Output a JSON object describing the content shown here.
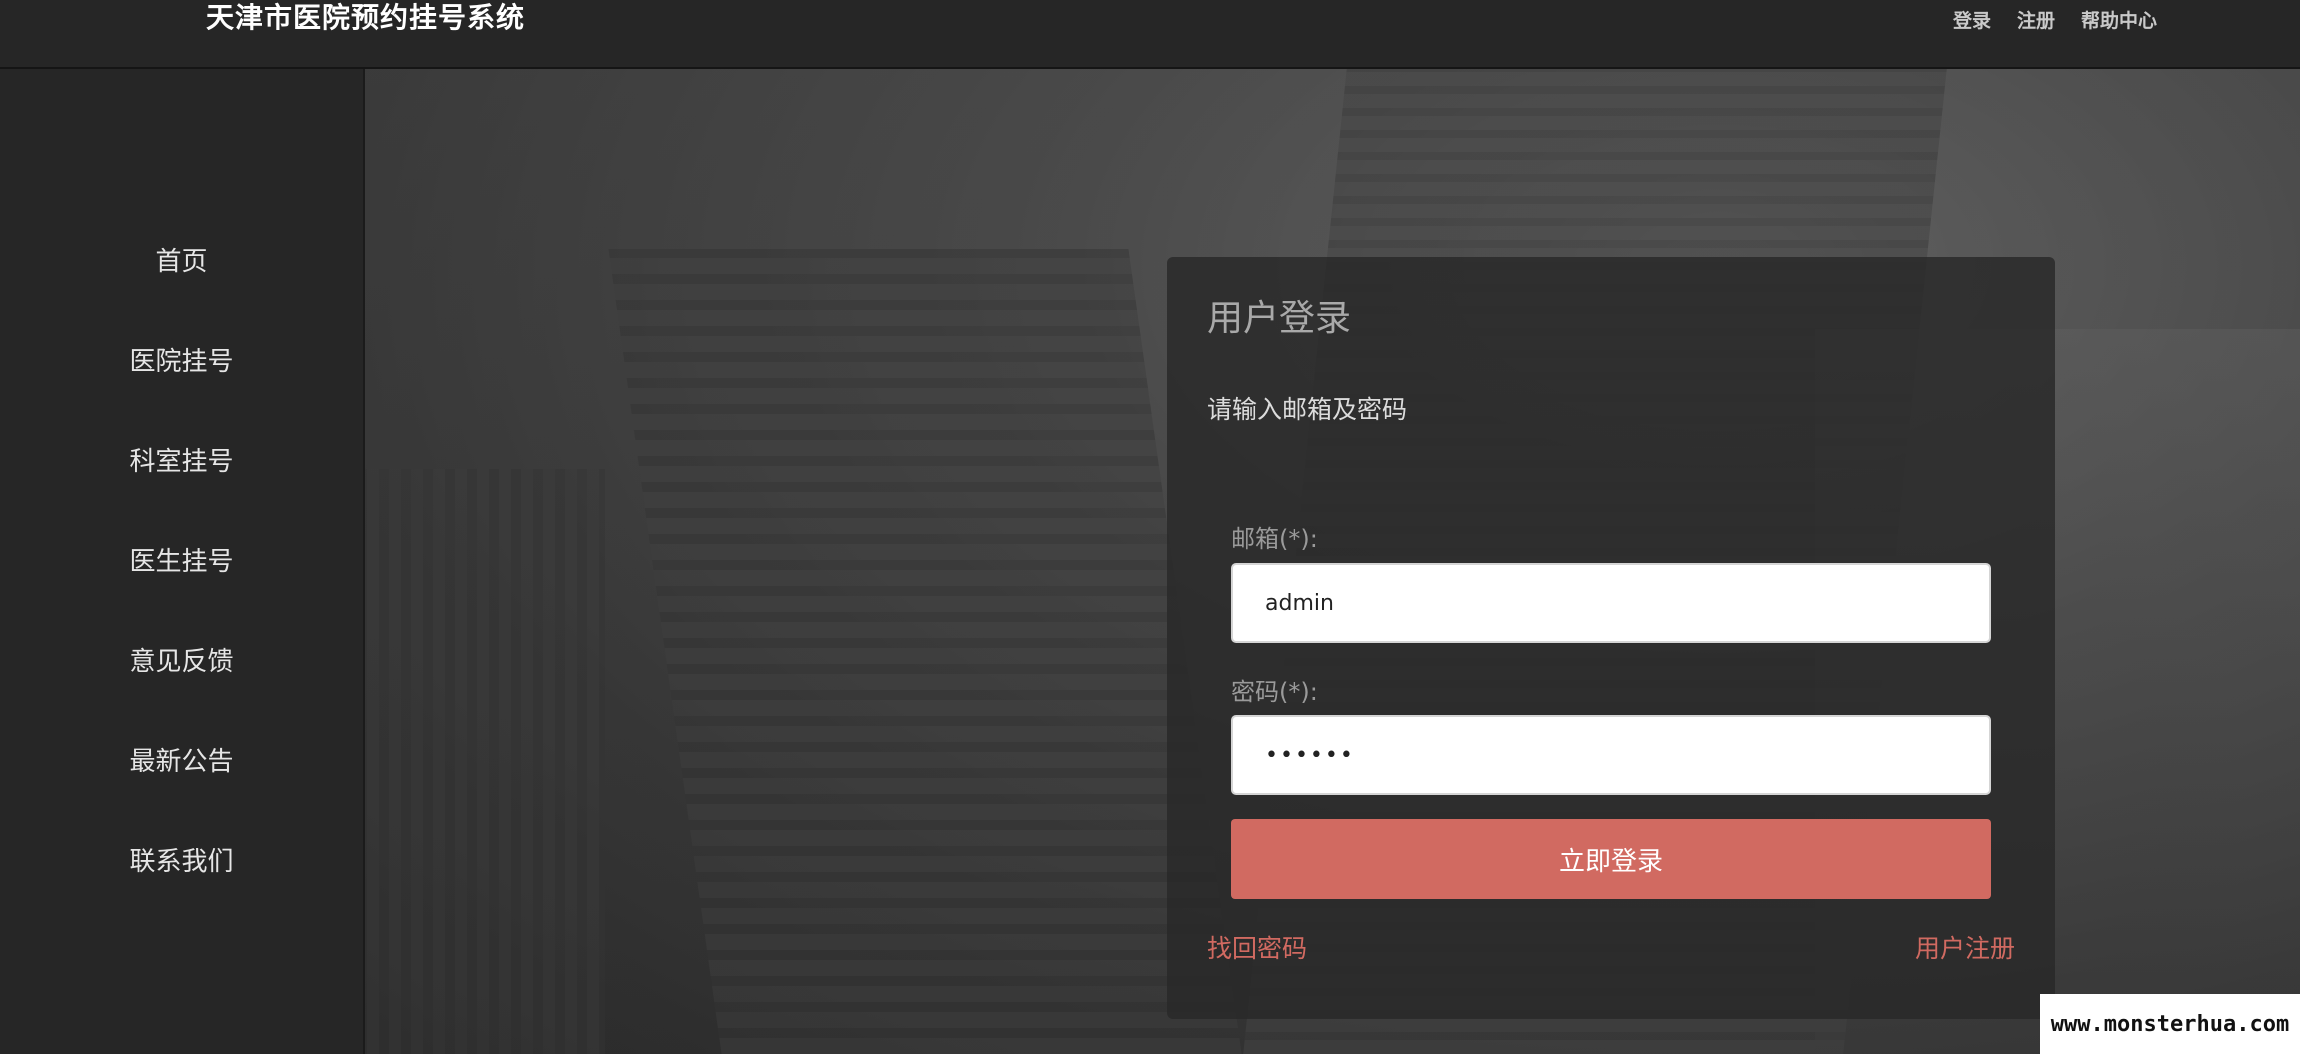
{
  "header": {
    "brand": "天津市医院预约挂号系统",
    "nav": [
      "登录",
      "注册",
      "帮助中心"
    ]
  },
  "sidebar": {
    "items": [
      "首页",
      "医院挂号",
      "科室挂号",
      "医生挂号",
      "意见反馈",
      "最新公告",
      "联系我们"
    ]
  },
  "login": {
    "title": "用户登录",
    "subtitle": "请输入邮箱及密码",
    "email_label": "邮箱(*):",
    "email_value": "admin",
    "password_label": "密码(*):",
    "password_value": "••••••",
    "submit_label": "立即登录",
    "forgot_label": "找回密码",
    "register_label": "用户注册"
  },
  "watermark": "www.monsterhua.com",
  "colors": {
    "accent": "#d16a61",
    "topbar_bg": "#262626",
    "sidebar_bg": "#262626"
  }
}
